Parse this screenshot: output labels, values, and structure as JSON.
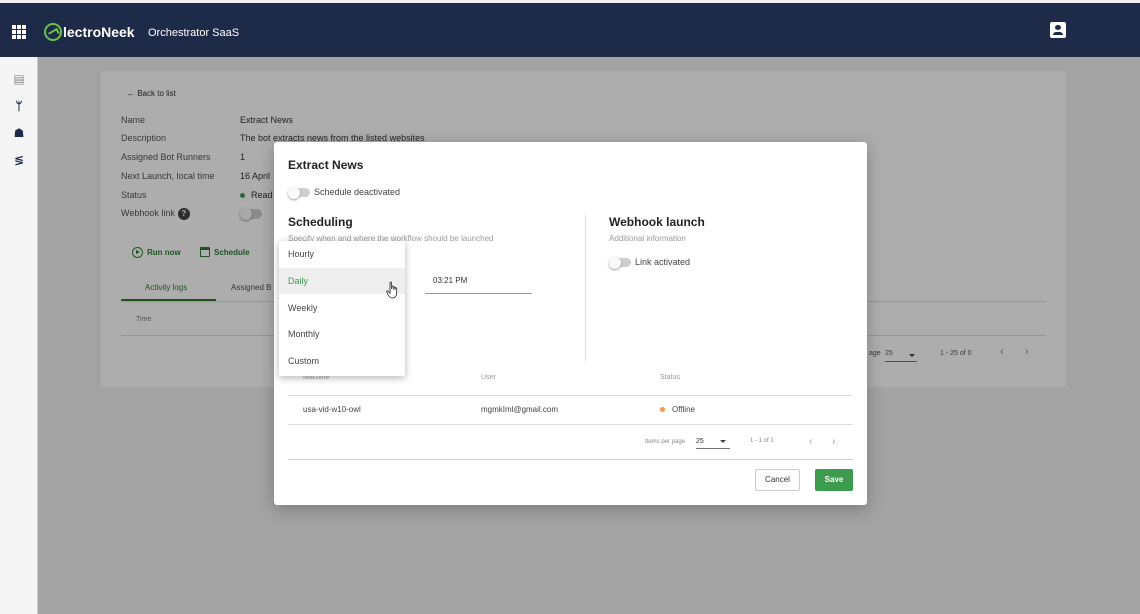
{
  "app": {
    "logo_text": "lectroNeek",
    "title": "Orchestrator SaaS"
  },
  "colors": {
    "topbar": "#1d2b48",
    "accent_green": "#3d9b4d",
    "offline": "#f2994a",
    "ready": "#3f9f4f"
  },
  "icons": {
    "topbar": [
      "apps-grid-icon",
      "electroneek-logo-icon",
      "user-account-icon"
    ],
    "sidebar": [
      "dashboard-icon",
      "workflow-icon",
      "bot-icon",
      "settings-sliders-icon"
    ]
  },
  "background": {
    "back_link": "← Back to list",
    "info": [
      {
        "label": "Name",
        "value": "Extract News"
      },
      {
        "label": "Description",
        "value": "The bot extracts news from the listed websites"
      },
      {
        "label": "Assigned Bot Runners",
        "value": "1"
      },
      {
        "label": "Next Launch, local time",
        "value": "16 April"
      },
      {
        "label": "Status",
        "value": "Read"
      },
      {
        "label": "Webhook link",
        "value": ""
      }
    ],
    "help_glyph": "?",
    "actions": {
      "run_now": "Run now",
      "schedule": "Schedule"
    },
    "tabs": [
      "Activity logs",
      "Assigned B"
    ],
    "table_header_time": "Time",
    "pager": {
      "items_label": "age",
      "per_page": "25",
      "range": "1 - 25 of 0",
      "prev": "‹",
      "next": "›"
    }
  },
  "modal": {
    "title": "Extract News",
    "schedule_toggle_label": "Schedule deactivated",
    "scheduling": {
      "heading": "Scheduling",
      "subtitle": "Specify when and where the workflow should be launched"
    },
    "time_value": "03:21 PM",
    "webhook": {
      "heading": "Webhook launch",
      "subtitle": "Additional information",
      "toggle_label": "Link activated"
    },
    "table": {
      "headers": [
        "Machine",
        "User",
        "Status"
      ],
      "rows": [
        {
          "machine": "usa-vid-w10-owl",
          "user": "mgmkIml@gmail.com",
          "status": "Offline"
        }
      ]
    },
    "pager": {
      "items_label": "Items per page",
      "per_page": "25",
      "range": "1 - 1 of 1",
      "prev": "‹",
      "next": "›"
    },
    "buttons": {
      "cancel": "Cancel",
      "save": "Save"
    }
  },
  "dropdown": {
    "options": [
      "Hourly",
      "Daily",
      "Weekly",
      "Monthly",
      "Custom"
    ],
    "selected": "Daily"
  }
}
